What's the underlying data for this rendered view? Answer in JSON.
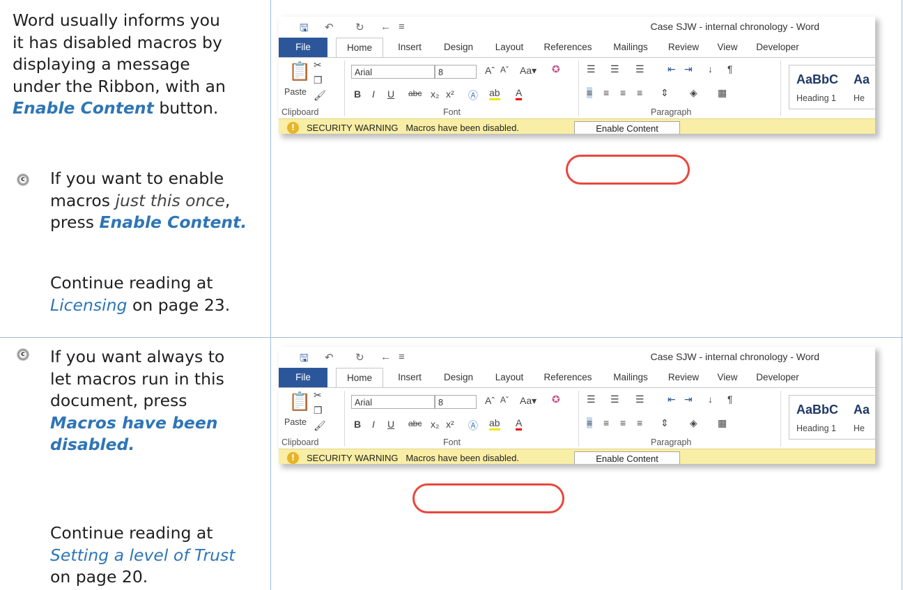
{
  "row1": {
    "intro": {
      "line1": "Word usually informs you",
      "line2": "it has disabled macros by",
      "line3": "displaying a message",
      "line4": "under the Ribbon, with an",
      "link": "Enable Content",
      "line5_rest": " button."
    },
    "bullet": {
      "line1": "If you want to enable",
      "line2_pre": "macros ",
      "line2_it": "just this once",
      "line2_post": ",",
      "line3_pre": "press ",
      "line3_link": "Enable Content."
    },
    "continue": {
      "line1": "Continue reading at",
      "link": "Licensing",
      "rest": " on page 23."
    }
  },
  "row2": {
    "bullet": {
      "line1": "If you want always to",
      "line2": "let macros run in this",
      "line3": "document, press",
      "link1": "Macros have been",
      "link2": "disabled."
    },
    "continue": {
      "line1": "Continue reading at",
      "link": "Setting a level of Trust",
      "rest": "on page 20."
    }
  },
  "bullet_glyph": "c",
  "word": {
    "title": "Case SJW - internal chronology - Word",
    "tabs": [
      "File",
      "Home",
      "Insert",
      "Design",
      "Layout",
      "References",
      "Mailings",
      "Review",
      "View",
      "Developer"
    ],
    "paste": "Paste",
    "font_name": "Arial",
    "font_size": "8",
    "groups": [
      "Clipboard",
      "Font",
      "Paragraph"
    ],
    "style_sample": "AaBbC",
    "style_sample2": "Aa",
    "style_name": "Heading 1",
    "style_name2": "He",
    "warning_title": "SECURITY WARNING",
    "warning_msg": "Macros have been disabled.",
    "enable_button": "Enable Content",
    "warning_icon": "!"
  },
  "colors": {
    "link": "#2e75b6",
    "file_tab": "#2b579a",
    "warning_bar": "#f9eea5",
    "highlight": "#e8473d",
    "grid": "#9fbcd6"
  }
}
